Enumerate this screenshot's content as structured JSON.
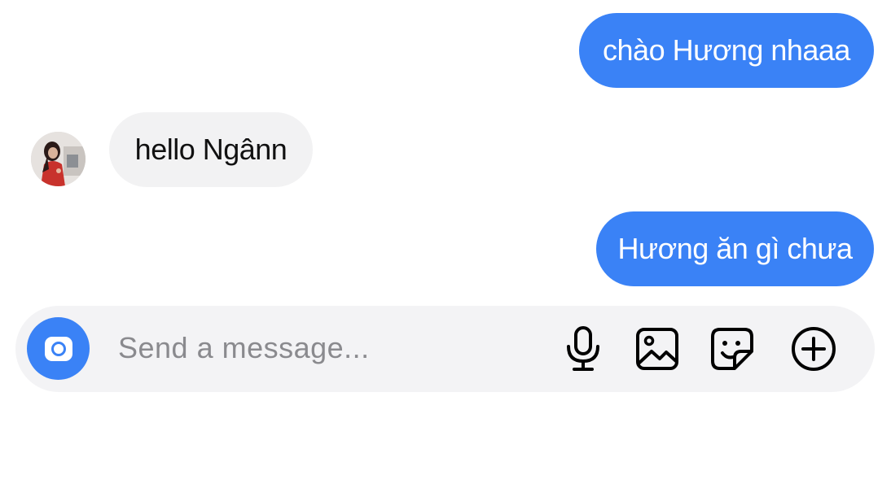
{
  "messages": [
    {
      "direction": "outgoing",
      "text": "chào Hương nhaaa"
    },
    {
      "direction": "incoming",
      "text": "hello Ngânn"
    },
    {
      "direction": "outgoing",
      "text": "Hương ăn gì chưa"
    }
  ],
  "composer": {
    "placeholder": "Send a message...",
    "icons": [
      "camera-icon",
      "microphone-icon",
      "image-icon",
      "sticker-icon",
      "plus-circle-icon"
    ]
  },
  "colors": {
    "outgoing_bubble": "#3a82f6",
    "incoming_bubble": "#f2f2f3",
    "composer_background": "#f3f3f5",
    "placeholder_text": "#8a8a8e"
  }
}
